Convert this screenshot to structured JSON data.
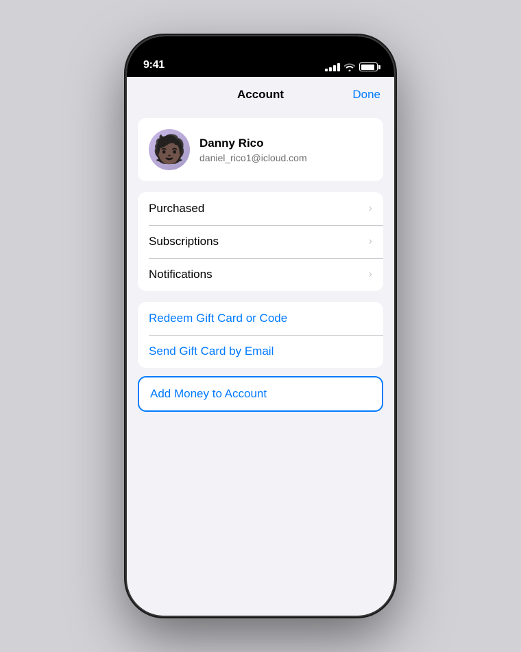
{
  "statusBar": {
    "time": "9:41",
    "signalBars": [
      4,
      6,
      8,
      10,
      12
    ],
    "batteryPercent": 90
  },
  "nav": {
    "title": "Account",
    "doneLabel": "Done"
  },
  "profile": {
    "name": "Danny Rico",
    "email": "daniel_rico1@icloud.com",
    "avatarEmoji": "🧑🏿‍🦱"
  },
  "menuItems": [
    {
      "label": "Purchased",
      "id": "purchased"
    },
    {
      "label": "Subscriptions",
      "id": "subscriptions"
    },
    {
      "label": "Notifications",
      "id": "notifications"
    }
  ],
  "actionItems": [
    {
      "label": "Redeem Gift Card or Code",
      "id": "redeem",
      "highlighted": false
    },
    {
      "label": "Send Gift Card by Email",
      "id": "send-gift",
      "highlighted": false
    },
    {
      "label": "Add Money to Account",
      "id": "add-money",
      "highlighted": true
    }
  ],
  "icons": {
    "chevron": "›",
    "wifi": "📶",
    "battery": "🔋"
  }
}
